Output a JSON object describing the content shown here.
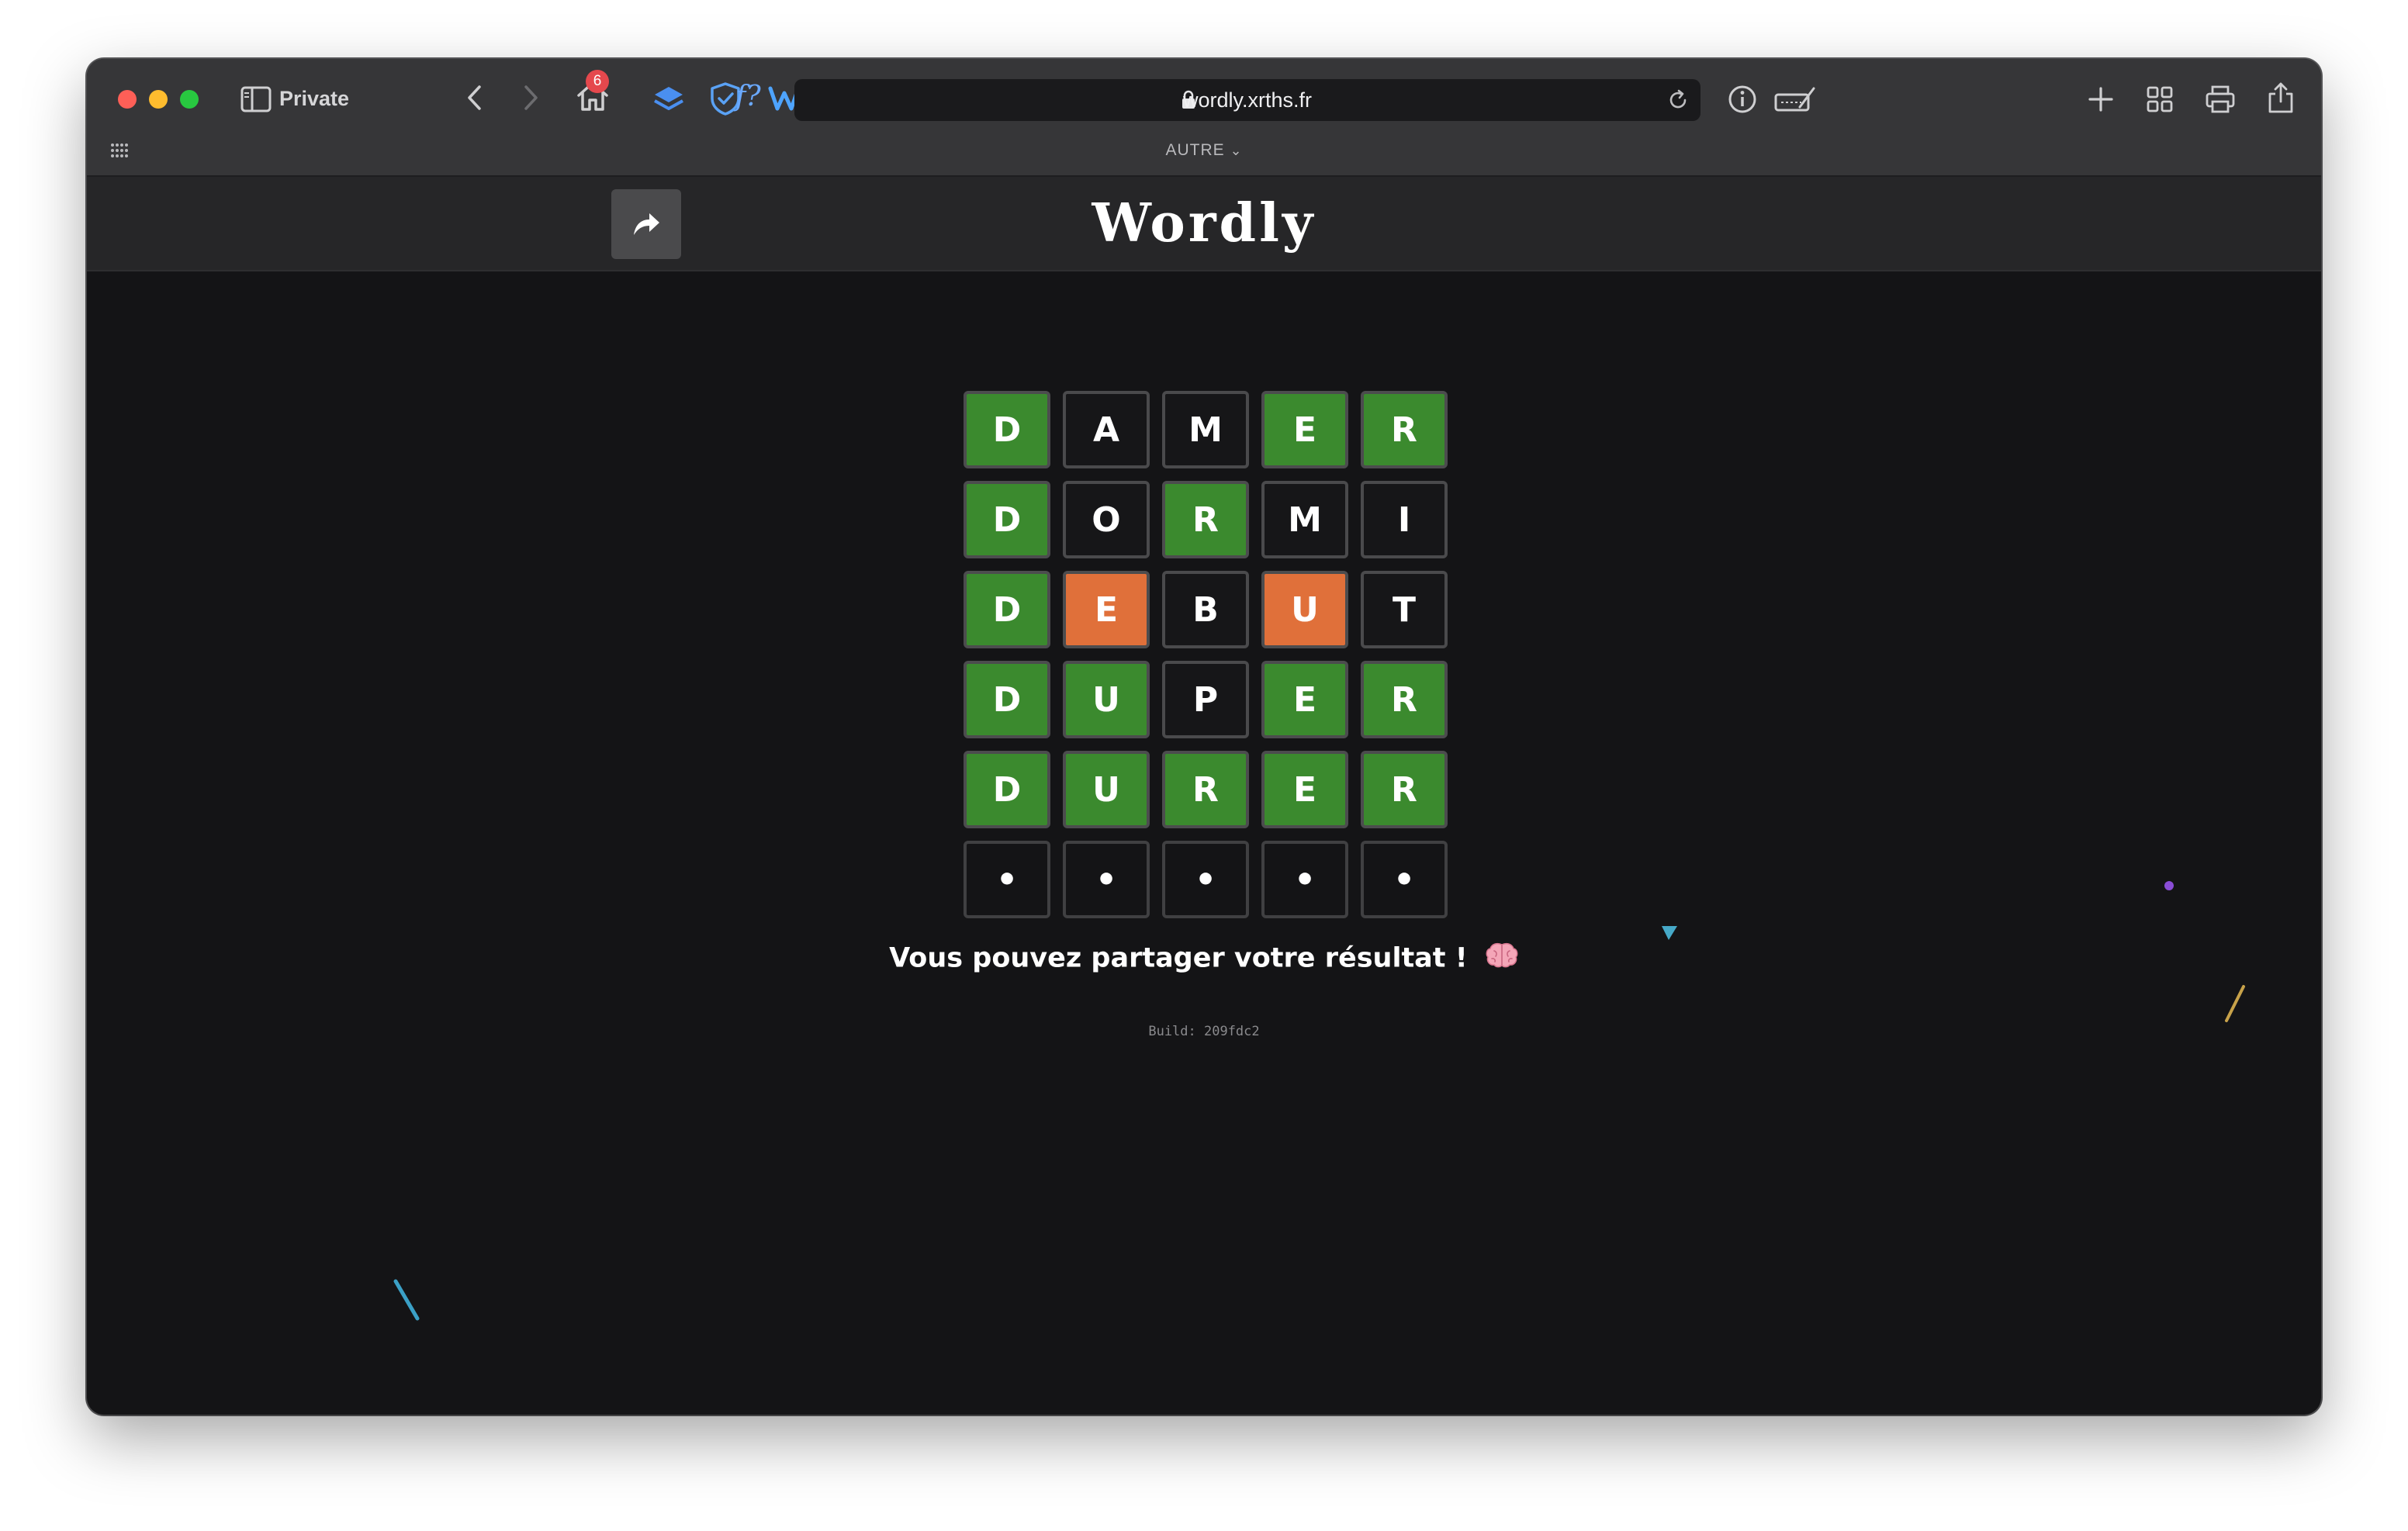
{
  "browser": {
    "mode_label": "Private",
    "tab_badge_count": "6",
    "fx_label": "f?",
    "url": "wordly.xrths.fr",
    "tab_group_label": "AUTRE"
  },
  "app": {
    "title": "Wordly",
    "share_button_icon": "share-arrow-icon"
  },
  "board": {
    "rows": [
      [
        {
          "letter": "D",
          "state": "correct"
        },
        {
          "letter": "A",
          "state": "absent"
        },
        {
          "letter": "M",
          "state": "absent"
        },
        {
          "letter": "E",
          "state": "correct"
        },
        {
          "letter": "R",
          "state": "correct"
        }
      ],
      [
        {
          "letter": "D",
          "state": "correct"
        },
        {
          "letter": "O",
          "state": "absent"
        },
        {
          "letter": "R",
          "state": "correct"
        },
        {
          "letter": "M",
          "state": "absent"
        },
        {
          "letter": "I",
          "state": "absent"
        }
      ],
      [
        {
          "letter": "D",
          "state": "correct"
        },
        {
          "letter": "E",
          "state": "present"
        },
        {
          "letter": "B",
          "state": "absent"
        },
        {
          "letter": "U",
          "state": "present"
        },
        {
          "letter": "T",
          "state": "absent"
        }
      ],
      [
        {
          "letter": "D",
          "state": "correct"
        },
        {
          "letter": "U",
          "state": "correct"
        },
        {
          "letter": "P",
          "state": "absent"
        },
        {
          "letter": "E",
          "state": "correct"
        },
        {
          "letter": "R",
          "state": "correct"
        }
      ],
      [
        {
          "letter": "D",
          "state": "correct"
        },
        {
          "letter": "U",
          "state": "correct"
        },
        {
          "letter": "R",
          "state": "correct"
        },
        {
          "letter": "E",
          "state": "correct"
        },
        {
          "letter": "R",
          "state": "correct"
        }
      ],
      [
        {
          "letter": "•",
          "state": "empty"
        },
        {
          "letter": "•",
          "state": "empty"
        },
        {
          "letter": "•",
          "state": "empty"
        },
        {
          "letter": "•",
          "state": "empty"
        },
        {
          "letter": "•",
          "state": "empty"
        }
      ]
    ]
  },
  "result_message": "Vous pouvez partager votre résultat !",
  "result_emoji_icon": "brain-icon",
  "build_label": "Build: 209fdc2",
  "colors": {
    "correct": "#3b8a2e",
    "present": "#e0703a",
    "absent": "#161618",
    "background": "#141416",
    "header": "#262628"
  }
}
